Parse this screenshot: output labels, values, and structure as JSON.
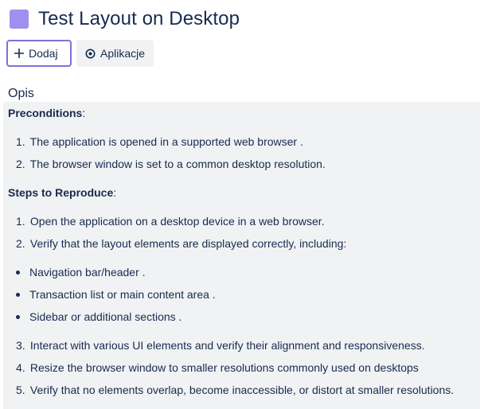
{
  "issue": {
    "title": "Test Layout on Desktop",
    "type_color": "#9f8fef"
  },
  "toolbar": {
    "add_label": "Dodaj",
    "add_icon": "plus-icon",
    "apps_label": "Aplikacje",
    "apps_icon": "apps-icon",
    "accent": "#8270db"
  },
  "description": {
    "label": "Opis",
    "preconditions_heading": "Preconditions",
    "preconditions": [
      "The application is opened in a supported web browser .",
      "The browser window is set to a common desktop resolution."
    ],
    "steps_heading": "Steps to Reproduce",
    "steps_a": [
      "Open the application on a desktop device in a web browser.",
      "Verify that the layout elements are displayed correctly, including:"
    ],
    "bullets": [
      "Navigation bar/header .",
      "Transaction list or main content area .",
      "Sidebar or additional sections ."
    ],
    "steps_b": [
      "Interact with various UI elements and verify their alignment and responsiveness.",
      "Resize the browser window to smaller resolutions commonly used on desktops",
      "Verify that no elements overlap, become inaccessible, or distort at smaller resolutions."
    ],
    "numbers": [
      "1.",
      "2.",
      "3.",
      "4.",
      "5."
    ],
    "colon": ":"
  }
}
